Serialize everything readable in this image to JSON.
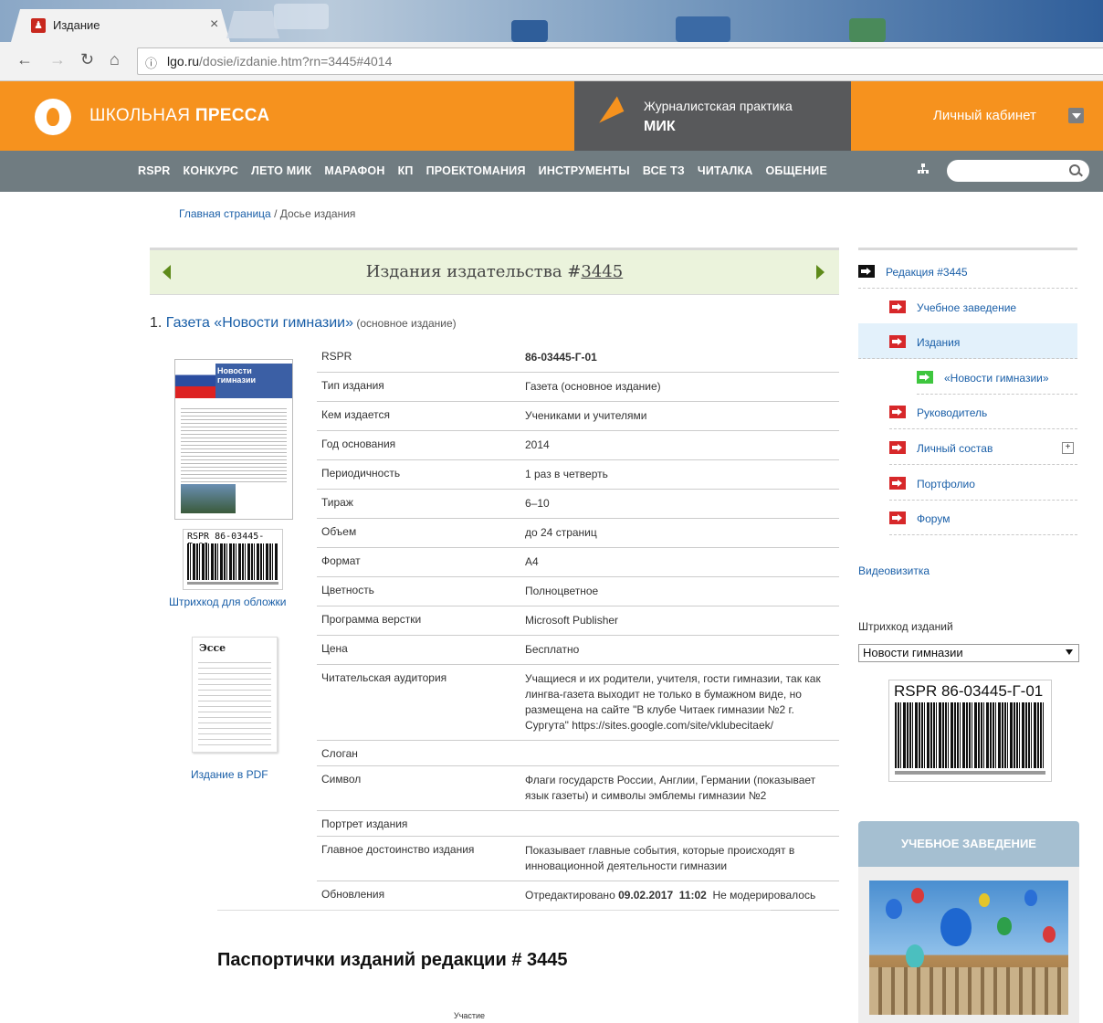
{
  "browser": {
    "tab_title": "Издание",
    "tab_close": "×",
    "url_host": "lgo.ru",
    "url_path": "/dosie/izdanie.htm?rn=3445#4014",
    "info_icon": "info-icon"
  },
  "header": {
    "brand_regular": "ШКОЛЬНАЯ ",
    "brand_bold": "ПРЕССА",
    "promo_line1": "Журналистская практика",
    "promo_line2": "МИК",
    "cabinet": "Личный кабинет",
    "brand_color": "#f6921e",
    "nav_color": "#707c81"
  },
  "nav": {
    "items": [
      "RSPR",
      "КОНКУРС",
      "ЛЕТО МИК",
      "МАРАФОН",
      "КП",
      "ПРОЕКТОМАНИЯ",
      "ИНСТРУМЕНТЫ",
      "ВСЕ ТЗ",
      "ЧИТАЛКА",
      "ОБЩЕНИЕ"
    ],
    "search_placeholder": ""
  },
  "breadcrumb": {
    "home": "Главная страница",
    "separator": " / ",
    "current": "Досье издания"
  },
  "banner": {
    "title_prefix": "Издания издательства #",
    "title_number": "3445"
  },
  "publication": {
    "index": "1. ",
    "name": "Газета «Новости гимназии»",
    "note": " (основное издание)",
    "cover_title": "Новости гимназии",
    "barcode_caption": "RSPR 86-03445-Г-01",
    "barcode_link": "Штрихкод для обложки",
    "essay_title": "Эссе издания",
    "pdf_link": "Издание в PDF"
  },
  "info_rows": [
    {
      "k": "RSPR",
      "v": "86-03445-Г-01",
      "bold": true
    },
    {
      "k": "Тип издания",
      "v": "Газета (основное издание)"
    },
    {
      "k": "Кем издается",
      "v": "Учениками и учителями"
    },
    {
      "k": "Год основания",
      "v": "2014"
    },
    {
      "k": "Периодичность",
      "v": "1 раз в четверть"
    },
    {
      "k": "Тираж",
      "v": "6–10"
    },
    {
      "k": "Объем",
      "v": "до 24 страниц"
    },
    {
      "k": "Формат",
      "v": "А4"
    },
    {
      "k": "Цветность",
      "v": "Полноцветное"
    },
    {
      "k": "Программа верстки",
      "v": "Microsoft Publisher"
    },
    {
      "k": "Цена",
      "v": "Бесплатно"
    },
    {
      "k": "Читательская аудитория",
      "v": "Учащиеся и их родители, учителя, гости гимназии, так как лингва-газета выходит не только в бумажном виде, но размещена на сайте \"В клубе Читаек гимназии №2 г. Сургута\" https://sites.google.com/site/vklubecitaek/"
    },
    {
      "k": "Слоган",
      "v": ""
    },
    {
      "k": "Символ",
      "v": "Флаги государств России, Англии, Германии (показывает язык газеты) и символы эмблемы гимназии №2"
    },
    {
      "k": "Портрет издания",
      "v": ""
    },
    {
      "k": "Главное достоинство издания",
      "v": "Показывает главные события, которые происходят в инновационной деятельности гимназии"
    },
    {
      "k": "Обновления",
      "v_pre": "Отредактировано ",
      "v_bold": "09.02.2017  11:02",
      "v_post": "  Не модерировалось"
    }
  ],
  "passports": {
    "title": "Паспортички изданий редакции # 3445",
    "note": "Участие"
  },
  "sidebar": {
    "items": [
      {
        "label": "Редакция #3445",
        "icon": "black",
        "level": 0
      },
      {
        "label": "Учебное заведение",
        "icon": "red",
        "level": 1
      },
      {
        "label": "Издания",
        "icon": "red",
        "level": 1,
        "active": true
      },
      {
        "label": "«Новости гимназии»",
        "icon": "green",
        "level": 2
      },
      {
        "label": "Руководитель",
        "icon": "red",
        "level": 1
      },
      {
        "label": "Личный состав",
        "icon": "red",
        "level": 1,
        "expand": "+"
      },
      {
        "label": "Портфолио",
        "icon": "red",
        "level": 1
      },
      {
        "label": "Форум",
        "icon": "red",
        "level": 1
      }
    ],
    "video": "Видеовизитка",
    "barcode_label": "Штрихкод изданий",
    "barcode_select": "Новости гимназии",
    "barcode_caption": "RSPR 86-03445-Г-01",
    "uz_title": "УЧЕБНОЕ ЗАВЕДЕНИЕ"
  }
}
